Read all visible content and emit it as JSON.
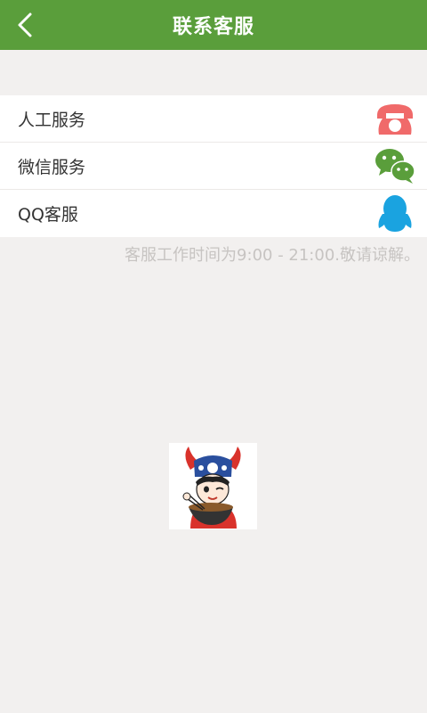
{
  "header": {
    "title": "联系客服",
    "back_icon": "chevron-left-icon",
    "bg_color": "#5a9e3b"
  },
  "menu": {
    "items": [
      {
        "label": "人工服务",
        "icon": "phone-icon",
        "icon_color": "#f06a6a"
      },
      {
        "label": "微信服务",
        "icon": "wechat-icon",
        "icon_color": "#5a9e3b"
      },
      {
        "label": "QQ客服",
        "icon": "qq-icon",
        "icon_color": "#1aa3e0"
      }
    ]
  },
  "note": "客服工作时间为9:00 - 21:00.敬请谅解。",
  "mascot": {
    "icon": "mascot-logo"
  }
}
